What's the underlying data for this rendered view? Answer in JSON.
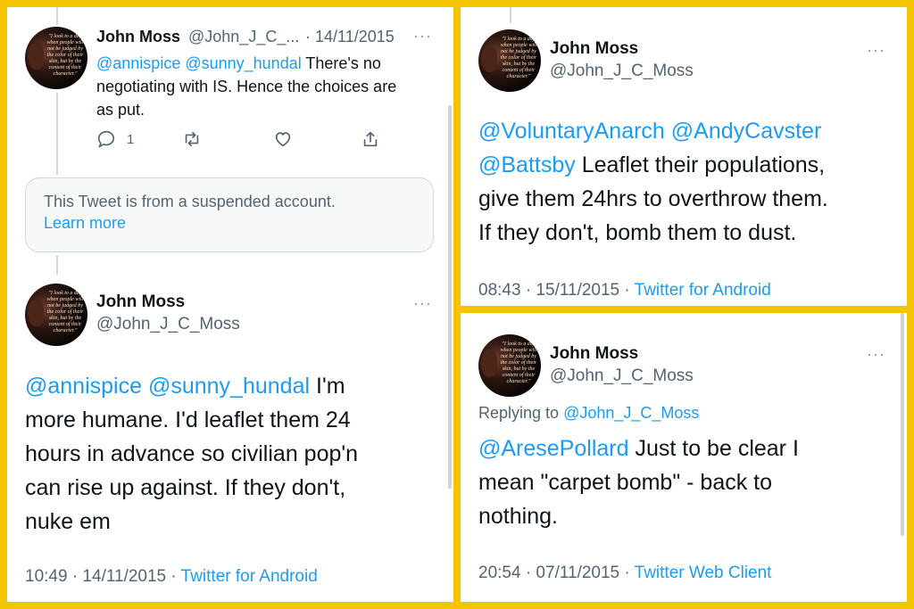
{
  "colors": {
    "frame": "#F5C400",
    "link": "#1d9bf0",
    "secondary": "#536471"
  },
  "panel_left": {
    "tweet1": {
      "name": "John Moss",
      "handle": "@John_J_C_...",
      "date": "· 14/11/2015",
      "more": "···",
      "mention1": "@annispice",
      "mention2": "@sunny_hundal",
      "text_first": "There's no",
      "text_rest": "negotiating with IS. Hence the choices are\nas put.",
      "reply_count": "1",
      "icons": [
        "reply-icon",
        "retweet-icon",
        "like-icon",
        "share-icon"
      ]
    },
    "suspended": {
      "text": "This Tweet is from a suspended account.",
      "learn_more": "Learn more"
    },
    "tweet2": {
      "name": "John Moss",
      "handle": "@John_J_C_Moss",
      "more": "···",
      "mention1": "@annispice",
      "mention2": "@sunny_hundal",
      "text_first": "I'm",
      "text_rest": "more humane. I'd leaflet them 24\nhours in advance so civilian pop'n\ncan rise up against. If they don't,\nnuke em",
      "time": "10:49 · 14/11/2015 · ",
      "client": "Twitter for Android"
    },
    "avatar_quote": "\"I look to a day when people will not be judged by the color of their skin, but by the content of their character.\""
  },
  "panel_top_right": {
    "name": "John Moss",
    "handle": "@John_J_C_Moss",
    "more": "···",
    "line1_mention1": "@VoluntaryAnarch",
    "line1_mention2": "@AndyCavster",
    "line2_mention": "@Battsby",
    "line2_text": "Leaflet their populations,",
    "text_rest": "give them 24hrs to overthrow them.\nIf they don't, bomb them to dust.",
    "time": "08:43 · 15/11/2015 · ",
    "client": "Twitter for Android"
  },
  "panel_bottom_right": {
    "name": "John Moss",
    "handle": "@John_J_C_Moss",
    "more": "···",
    "replying_prefix": "Replying to",
    "replying_handle": "@John_J_C_Moss",
    "mention": "@AresePollard",
    "text_first": "Just to be clear I",
    "text_rest": "mean \"carpet bomb\" - back to\nnothing.",
    "time": "20:54 · 07/11/2015 · ",
    "client": "Twitter Web Client"
  }
}
